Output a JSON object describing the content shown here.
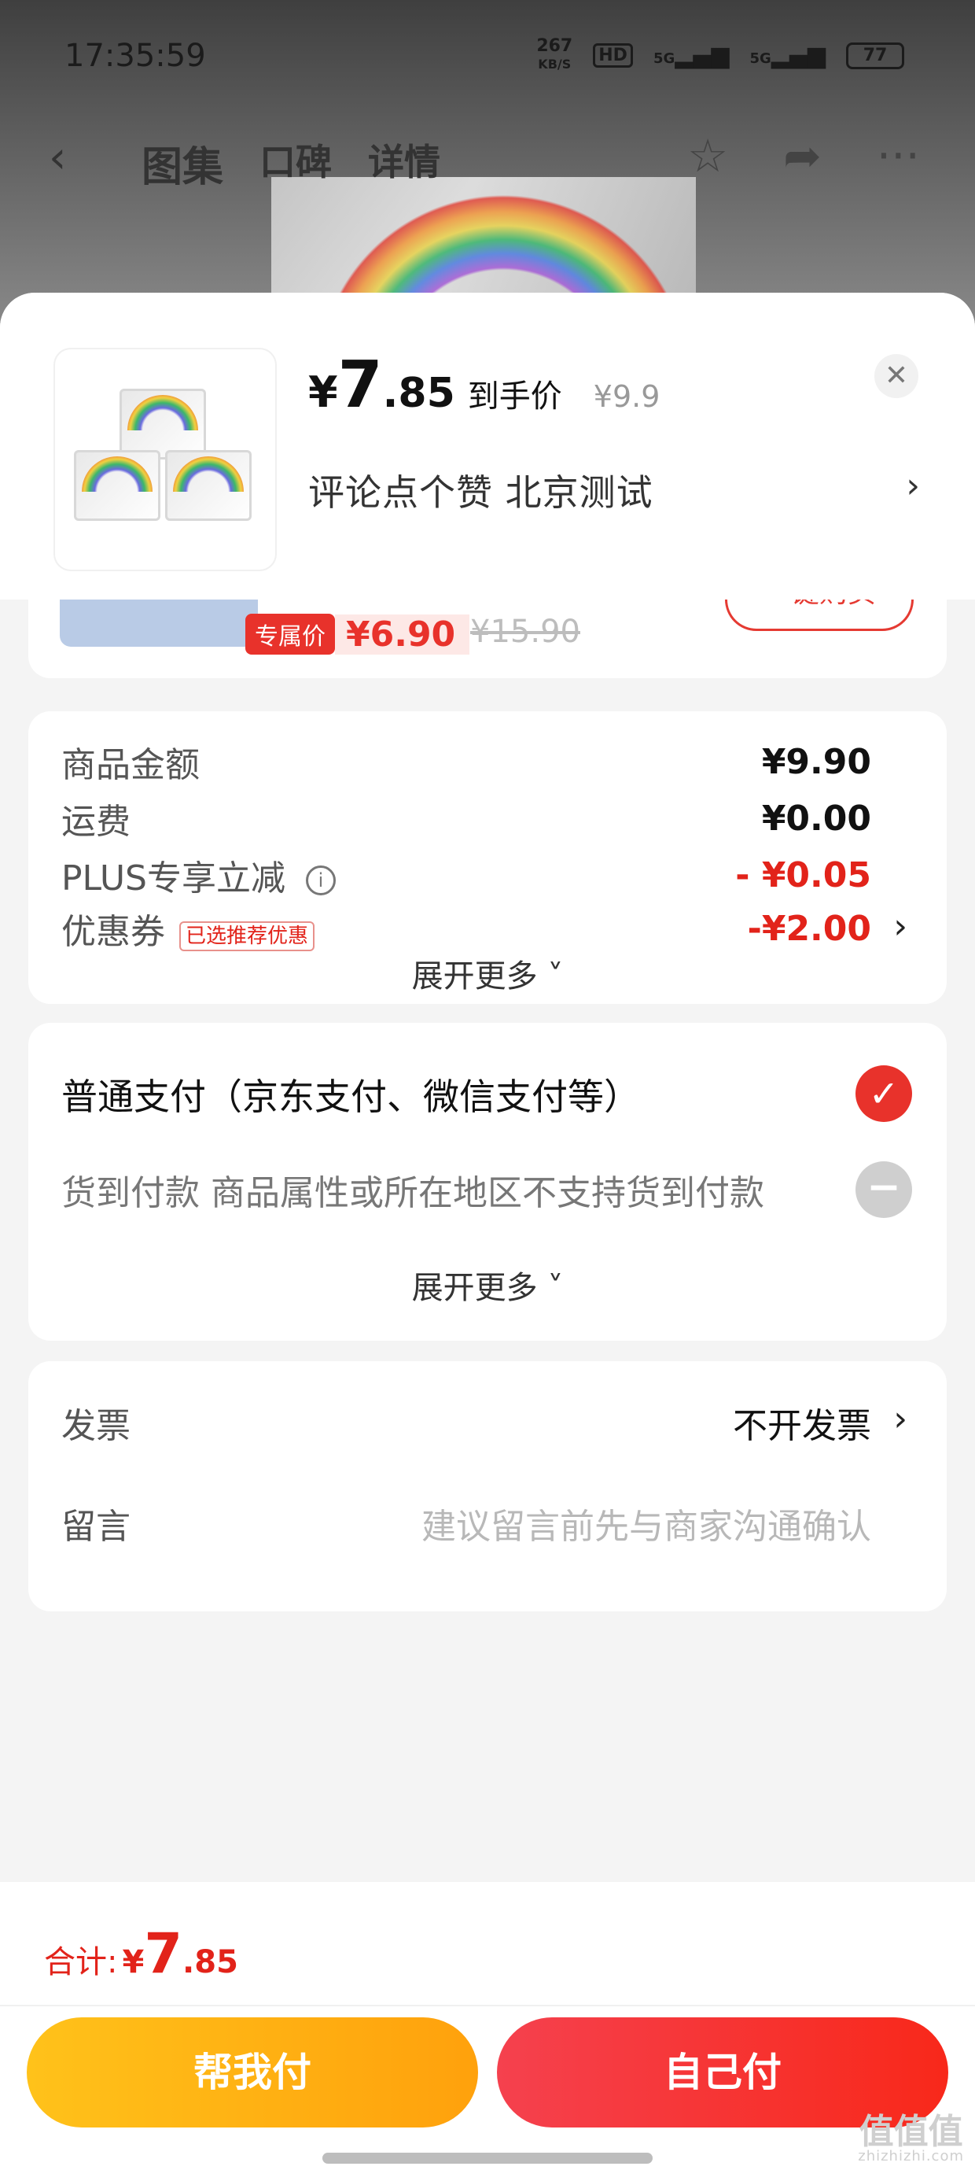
{
  "status_bar": {
    "time": "17:35:59",
    "speed": "267",
    "speed_unit": "KB/S",
    "hd": "HD",
    "net1": "5G",
    "net2": "5G",
    "battery": "77"
  },
  "top_nav": {
    "tabs": [
      "图集",
      "口碑",
      "详情"
    ]
  },
  "sheet": {
    "price_symbol": "¥",
    "price_int": "7",
    "price_dec": ".85",
    "price_label": "到手价",
    "original_price": "¥9.9",
    "address": "评论点个赞  北京测试"
  },
  "recommend": {
    "tag": "专属价",
    "price": "¥6.90",
    "old_price": "¥15.90",
    "buy_label": "一键购买"
  },
  "summary": {
    "goods_amount_label": "商品金额",
    "goods_amount": "¥9.90",
    "shipping_label": "运费",
    "shipping": "¥0.00",
    "plus_label": "PLUS专享立减",
    "plus_value": "- ¥0.05",
    "coupon_label": "优惠券",
    "coupon_badge": "已选推荐优惠",
    "coupon_value": "-¥2.00",
    "more_label": "展开更多"
  },
  "payment": {
    "normal": "普通支付（京东支付、微信支付等）",
    "cod": "货到付款 商品属性或所在地区不支持货到付款",
    "more_label": "展开更多"
  },
  "extra": {
    "invoice_label": "发票",
    "invoice_value": "不开发票",
    "memo_label": "留言",
    "memo_placeholder": "建议留言前先与商家沟通确认"
  },
  "bottom": {
    "total_label": "合计:",
    "total_cur": "¥",
    "total_int": "7",
    "total_dec": ".85",
    "help_pay": "帮我付",
    "self_pay": "自己付"
  },
  "watermark": {
    "main": "值值值",
    "sub": "zhizhizhi.com"
  },
  "colors": {
    "accent_red": "#e2231a",
    "yellow": "#ffb012"
  }
}
